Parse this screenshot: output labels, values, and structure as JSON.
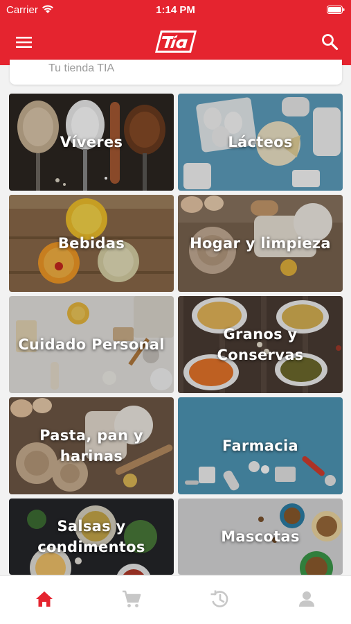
{
  "status_bar": {
    "carrier": "Carrier",
    "time": "1:14 PM"
  },
  "header": {
    "logo_text": "Tía",
    "menu_icon": "hamburger-menu-icon",
    "search_icon": "search-icon"
  },
  "store": {
    "label": "Tu tienda TIA"
  },
  "categories": [
    {
      "label": "Víveres"
    },
    {
      "label": "Lácteos"
    },
    {
      "label": "Bebidas"
    },
    {
      "label": "Hogar y limpieza"
    },
    {
      "label": "Cuidado Personal"
    },
    {
      "label": "Granos y Conservas"
    },
    {
      "label": "Pasta, pan y harinas"
    },
    {
      "label": "Farmacia"
    },
    {
      "label": "Salsas y condimentos"
    },
    {
      "label": "Mascotas"
    }
  ],
  "tabbar": {
    "active_color": "#e5242f",
    "inactive_color": "#c7c7c7",
    "tabs": [
      {
        "icon": "home-icon",
        "active": true
      },
      {
        "icon": "cart-icon",
        "active": false
      },
      {
        "icon": "history-icon",
        "active": false
      },
      {
        "icon": "profile-icon",
        "active": false
      }
    ]
  },
  "colors": {
    "brand_red": "#e5242f"
  }
}
